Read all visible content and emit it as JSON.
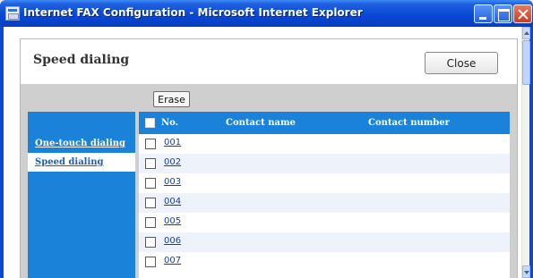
{
  "window": {
    "title": "Internet FAX Configuration - Microsoft Internet Explorer"
  },
  "page": {
    "title": "Speed dialing",
    "close_label": "Close",
    "erase_label": "Erase"
  },
  "sidebar": {
    "items": [
      {
        "label": "One-touch dialing",
        "active": false
      },
      {
        "label": "Speed dialing",
        "active": true
      }
    ]
  },
  "table": {
    "headers": {
      "no": "No.",
      "name": "Contact name",
      "number": "Contact number"
    },
    "rows": [
      {
        "no": "001",
        "name": "",
        "number": ""
      },
      {
        "no": "002",
        "name": "",
        "number": ""
      },
      {
        "no": "003",
        "name": "",
        "number": ""
      },
      {
        "no": "004",
        "name": "",
        "number": ""
      },
      {
        "no": "005",
        "name": "",
        "number": ""
      },
      {
        "no": "006",
        "name": "",
        "number": ""
      },
      {
        "no": "007",
        "name": "",
        "number": ""
      }
    ]
  },
  "colors": {
    "titlebar": "#0a48d6",
    "accent": "#1a82d8",
    "panel_gray": "#cfcfcf",
    "link": "#1a3f9a"
  }
}
